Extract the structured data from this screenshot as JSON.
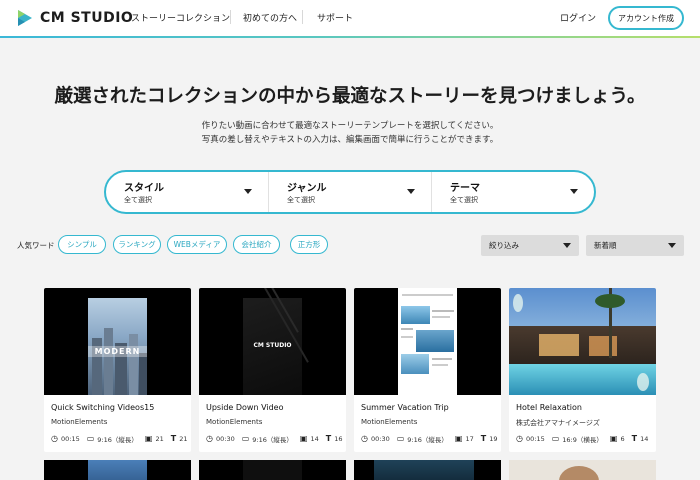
{
  "header": {
    "logo_text": "CM STUDIO",
    "nav": [
      {
        "label": "ストーリーコレクション"
      },
      {
        "label": "初めての方へ"
      },
      {
        "label": "サポート"
      }
    ],
    "login_label": "ログイン",
    "account_label": "アカウント作成"
  },
  "hero": {
    "title": "厳選されたコレクションの中から最適なストーリーを見つけましょう。",
    "subtitle_lines": [
      "作りたい動画に合わせて最適なストーリーテンプレートを選択してください。",
      "写真の差し替えやテキストの入力は、編集画面で簡単に行うことができます。"
    ]
  },
  "search": {
    "segments": [
      {
        "label": "スタイル",
        "value": "全て選択"
      },
      {
        "label": "ジャンル",
        "value": "全て選択"
      },
      {
        "label": "テーマ",
        "value": "全て選択"
      }
    ]
  },
  "popular": {
    "label": "人気ワード",
    "chips": [
      "シンプル",
      "ランキング",
      "WEBメディア",
      "会社紹介",
      "正方形"
    ]
  },
  "filters": {
    "refine_label": "絞り込み",
    "sort_label": "新着順"
  },
  "cards": [
    {
      "title": "Quick Switching Videos15",
      "author": "MotionElements",
      "duration": "00:15",
      "ratio": "9:16（縦長）",
      "images": "21",
      "texts": "21",
      "thumb_text": "MODERN"
    },
    {
      "title": "Upside Down Video",
      "author": "MotionElements",
      "duration": "00:30",
      "ratio": "9:16（縦長）",
      "images": "14",
      "texts": "16",
      "thumb_text": "CM STUDIO"
    },
    {
      "title": "Summer Vacation Trip",
      "author": "MotionElements",
      "duration": "00:30",
      "ratio": "9:16（縦長）",
      "images": "17",
      "texts": "19"
    },
    {
      "title": "Hotel Relaxation",
      "author": "株式会社アマナイメージズ",
      "duration": "00:15",
      "ratio": "16:9（横長）",
      "images": "6",
      "texts": "14"
    }
  ],
  "colors": {
    "accent": "#35b8d0",
    "chip_text": "#2aa7c0",
    "page_bg": "#f3f3f3"
  },
  "icons": {
    "duration": "clock-icon",
    "ratio": "aspect-ratio-icon",
    "images": "image-icon",
    "texts": "text-icon",
    "select": "caret-down-icon"
  }
}
